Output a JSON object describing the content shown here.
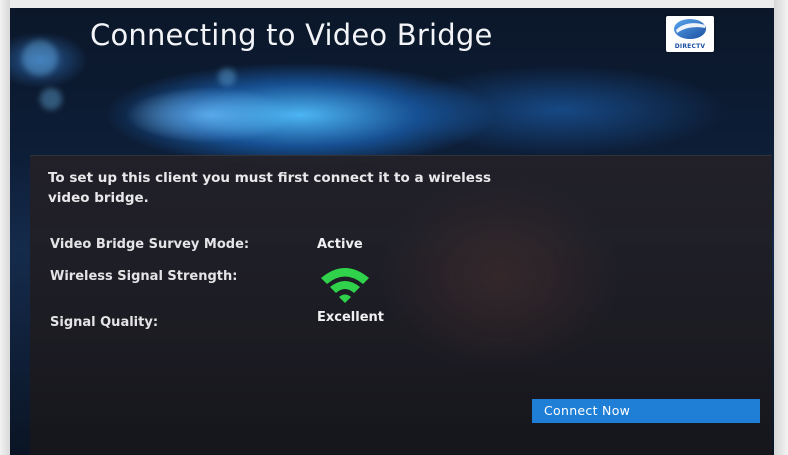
{
  "header": {
    "title": "Connecting to Video Bridge",
    "logo_text": "DIRECTV"
  },
  "panel": {
    "intro": "To set up this client you must first connect it to a wireless video bridge.",
    "rows": [
      {
        "label": "Video Bridge Survey Mode:",
        "value": "Active"
      },
      {
        "label": "Wireless Signal Strength:",
        "value_icon": "wifi-signal-icon",
        "signal_level": "full"
      },
      {
        "label": "Signal Quality:",
        "value": "Excellent"
      }
    ]
  },
  "actions": {
    "connect_label": "Connect Now"
  },
  "colors": {
    "accent_button": "#1f7fd6",
    "signal_green": "#2fd24a",
    "logo_blue": "#1b4fa0"
  }
}
